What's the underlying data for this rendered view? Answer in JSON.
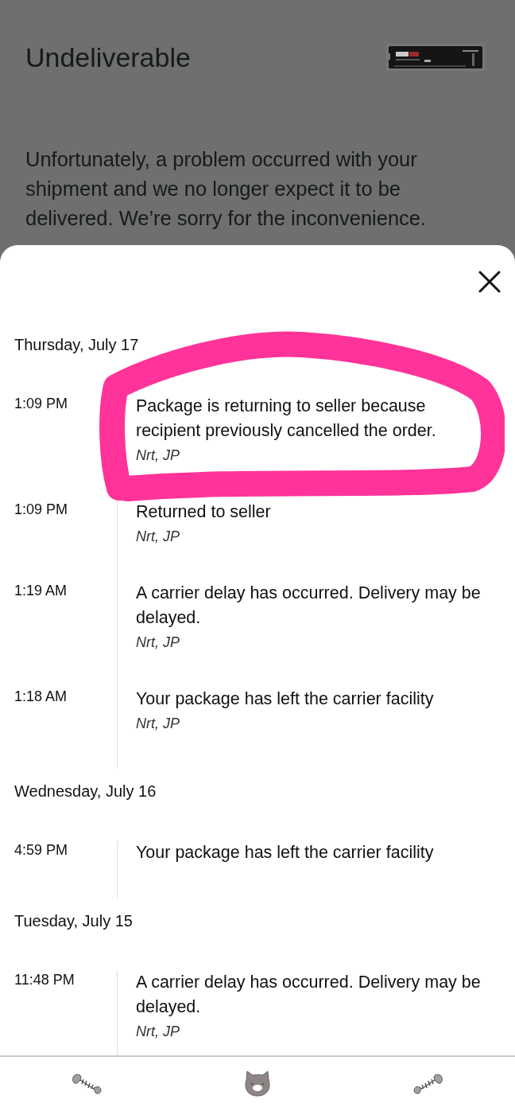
{
  "background": {
    "title": "Undeliverable",
    "kind": "picture",
    "message": "Unfortunately, a problem occurred with your shipment and we no longer expect it to be delivered. We’re sorry for the inconvenience."
  },
  "tracking": [
    {
      "date": "Thursday, July 17",
      "events": [
        {
          "time": "1:09 PM",
          "description": "Package is returning to seller because recipient previously cancelled the order.",
          "location": "Nrt, JP"
        },
        {
          "time": "1:09 PM",
          "description": "Returned to seller",
          "location": "Nrt, JP"
        },
        {
          "time": "1:19 AM",
          "description": "A carrier delay has occurred. Delivery may be delayed.",
          "location": "Nrt, JP"
        },
        {
          "time": "1:18 AM",
          "description": "Your package has left the carrier facility",
          "location": "Nrt, JP"
        }
      ]
    },
    {
      "date": "Wednesday, July 16",
      "events": [
        {
          "time": "4:59 PM",
          "description": "Your package has left the carrier facility"
        }
      ]
    },
    {
      "date": "Tuesday, July 15",
      "events": [
        {
          "time": "11:48 PM",
          "description": "A carrier delay has occurred. Delivery may be delayed.",
          "location": "Nrt, JP"
        }
      ]
    }
  ]
}
